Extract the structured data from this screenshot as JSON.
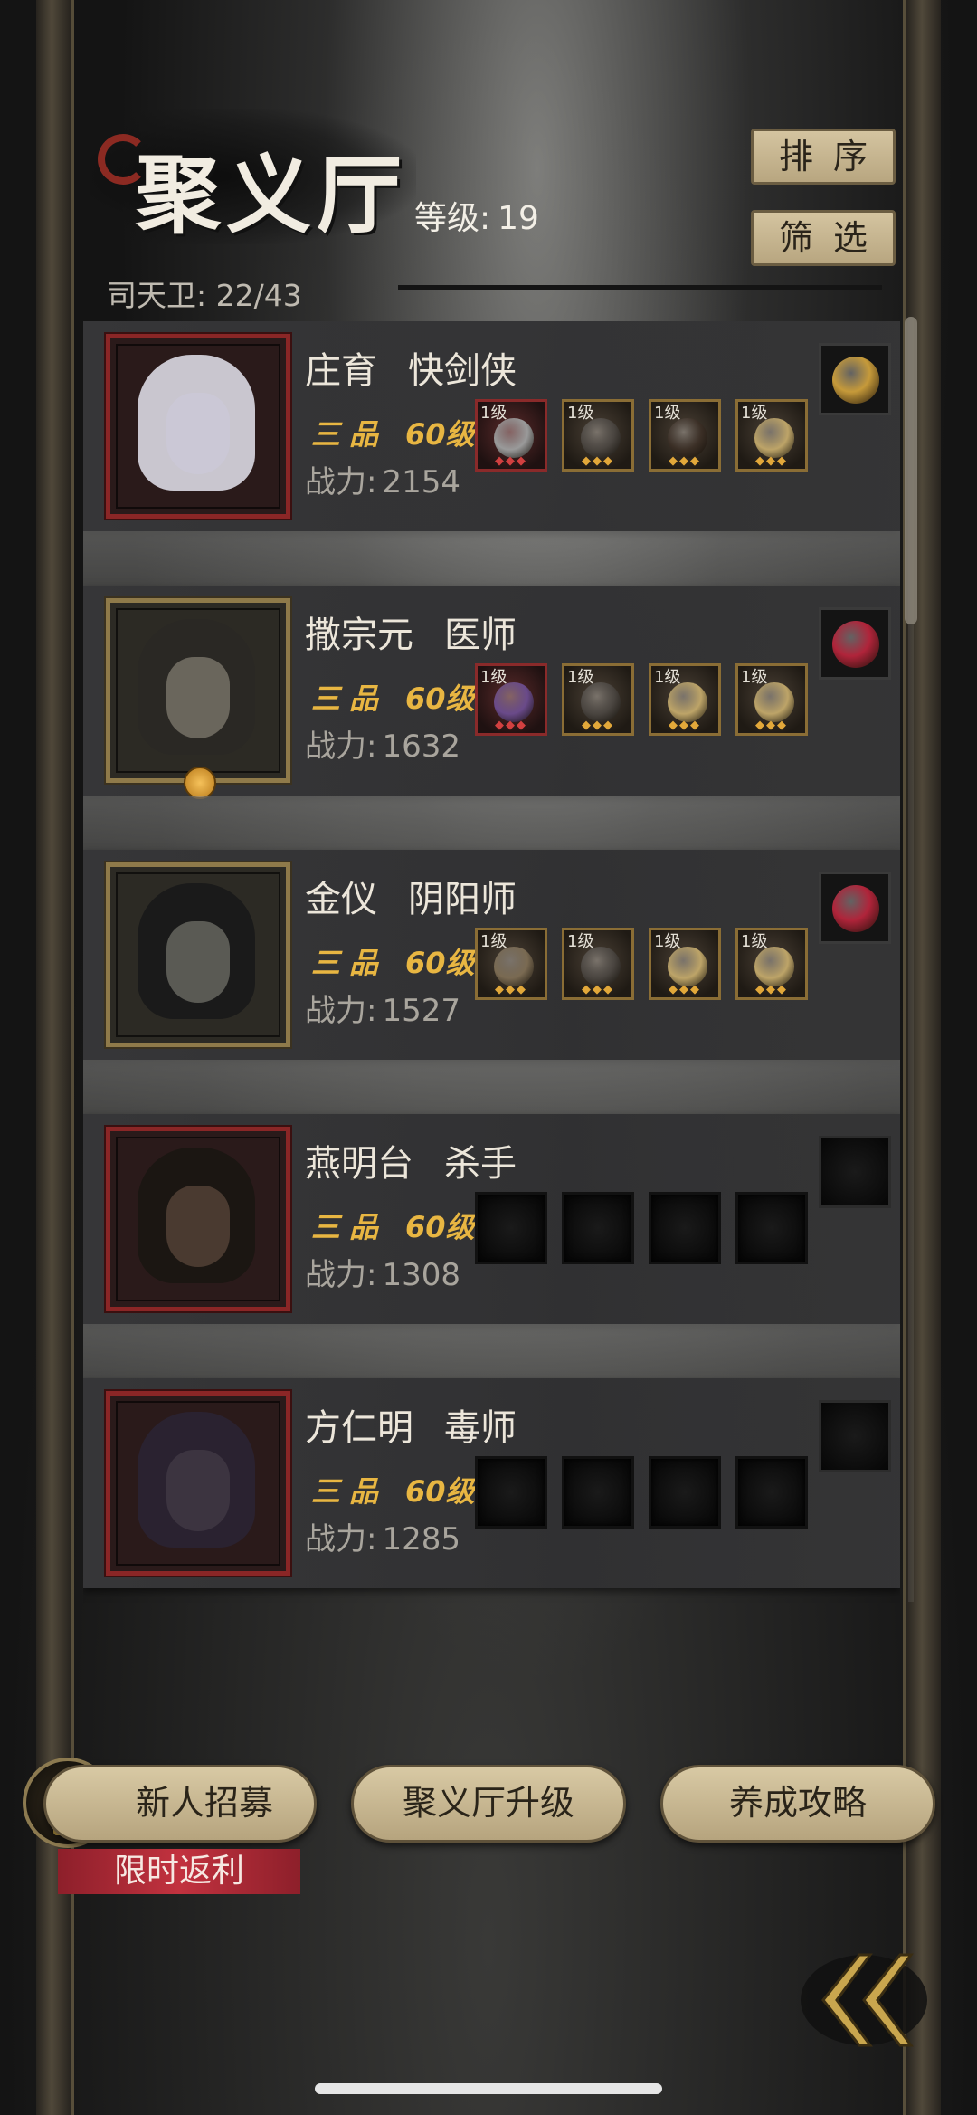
{
  "header": {
    "title": "聚义厅",
    "level_label": "等级:",
    "level_value": "19",
    "guard_label": "司天卫:",
    "guard_value": "22/43",
    "sort_button": "排序",
    "filter_button": "筛选"
  },
  "members": [
    {
      "name": "庄育",
      "role": "快剑侠",
      "rank": "三品",
      "level": "60级",
      "power_label": "战力:",
      "power": "2154",
      "frame": "red",
      "equipment": [
        {
          "level": "1级",
          "icon": "sword-icon",
          "quality": "red"
        },
        {
          "level": "1级",
          "icon": "armor-icon",
          "quality": "gold"
        },
        {
          "level": "1级",
          "icon": "boots-icon",
          "quality": "gold"
        },
        {
          "level": "1级",
          "icon": "jade-pendant-icon",
          "quality": "gold"
        }
      ],
      "charm_icon": "golden-amulet-icon"
    },
    {
      "name": "撒宗元",
      "role": "医师",
      "rank": "三品",
      "level": "60级",
      "power_label": "战力:",
      "power": "1632",
      "frame": "gold",
      "equipment": [
        {
          "level": "1级",
          "icon": "gourd-icon",
          "quality": "red"
        },
        {
          "level": "1级",
          "icon": "armor-icon",
          "quality": "gold"
        },
        {
          "level": "1级",
          "icon": "jade-pendant-icon",
          "quality": "gold"
        },
        {
          "level": "1级",
          "icon": "jade-pendant-icon",
          "quality": "gold"
        }
      ],
      "charm_icon": "red-gem-icon"
    },
    {
      "name": "金仪",
      "role": "阴阳师",
      "rank": "三品",
      "level": "60级",
      "power_label": "战力:",
      "power": "1527",
      "frame": "gold",
      "equipment": [
        {
          "level": "1级",
          "icon": "whisk-icon",
          "quality": "gold"
        },
        {
          "level": "1级",
          "icon": "armor-icon",
          "quality": "gold"
        },
        {
          "level": "1级",
          "icon": "jade-pendant-icon",
          "quality": "gold"
        },
        {
          "level": "1级",
          "icon": "jade-pendant-icon",
          "quality": "gold"
        }
      ],
      "charm_icon": "red-gem-icon"
    },
    {
      "name": "燕明台",
      "role": "杀手",
      "rank": "三品",
      "level": "60级",
      "power_label": "战力:",
      "power": "1308",
      "frame": "red",
      "equipment": [],
      "charm_icon": ""
    },
    {
      "name": "方仁明",
      "role": "毒师",
      "rank": "三品",
      "level": "60级",
      "power_label": "战力:",
      "power": "1285",
      "frame": "red",
      "equipment": [],
      "charm_icon": ""
    }
  ],
  "footer": {
    "recruit_button": "新人招募",
    "upgrade_button": "聚义厅升级",
    "guide_button": "养成攻略",
    "promo_label": "限时返利"
  },
  "colors": {
    "rank_gold": "#e8b642",
    "button_beige": "#d4c4a0",
    "promo_red": "#c2323f",
    "frame_red": "#8a2626",
    "frame_gold": "#8f7a4a"
  }
}
